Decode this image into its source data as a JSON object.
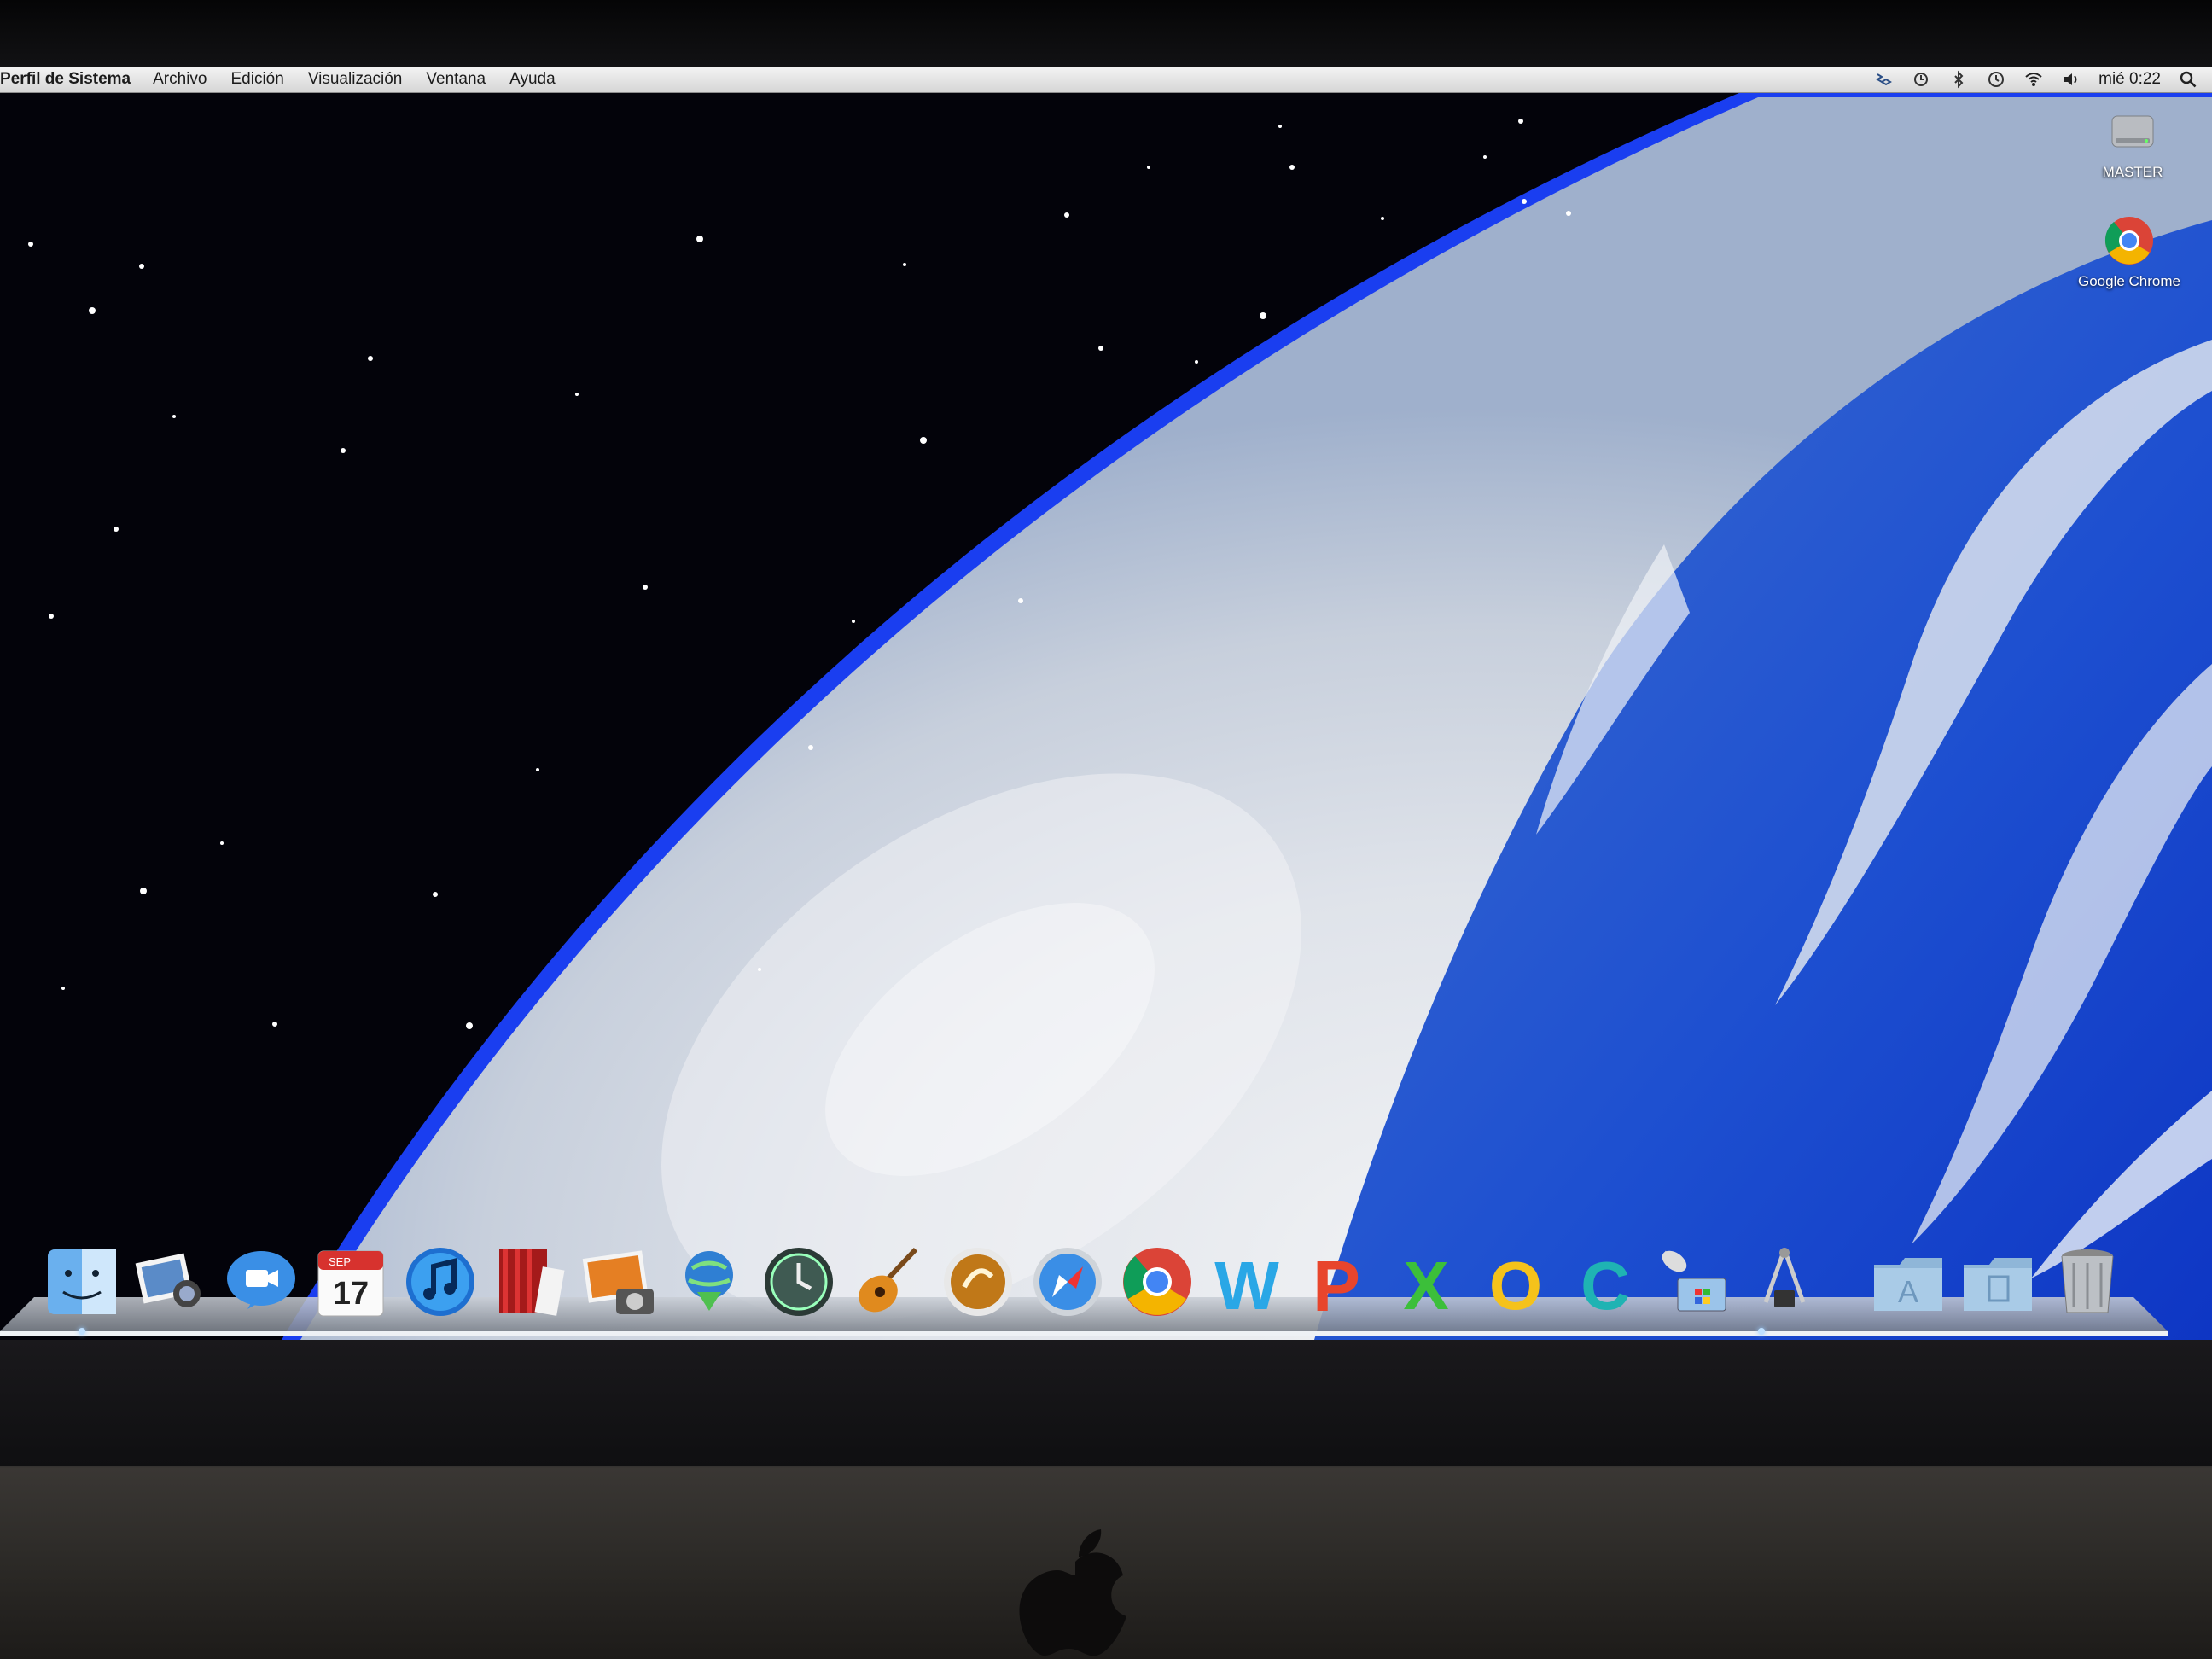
{
  "menubar": {
    "app_name": "Perfil de Sistema",
    "menus": [
      "Archivo",
      "Edición",
      "Visualización",
      "Ventana",
      "Ayuda"
    ],
    "clock": "mié 0:22",
    "status_icons": [
      "dropbox-icon",
      "sync-icon",
      "bluetooth-icon",
      "time-machine-icon",
      "wifi-icon",
      "volume-icon",
      "spotlight-icon"
    ]
  },
  "desktop": {
    "icons": [
      {
        "label": "MASTER",
        "icon": "hard-drive-icon"
      },
      {
        "label": "Google Chrome",
        "icon": "chrome-icon"
      }
    ]
  },
  "dock": {
    "items": [
      "finder-icon",
      "iphoto-preview-icon",
      "facetime-icon",
      "ical-icon",
      "itunes-icon",
      "photo-booth-icon",
      "iphoto-icon",
      "download-globe-icon",
      "time-machine-icon",
      "garageband-icon",
      "wine-bottler-icon",
      "safari-icon",
      "chrome-icon",
      "word-icon",
      "powerpoint-icon",
      "excel-icon",
      "outlook-icon",
      "communicator-icon",
      "remote-desktop-icon",
      "system-profiler-icon",
      "applications-folder-icon",
      "documents-folder-icon",
      "trash-icon"
    ],
    "calendar_month": "SEP",
    "calendar_day": "17",
    "word_letter": "W",
    "powerpoint_letter": "P",
    "excel_letter": "X",
    "outlook_letter": "O",
    "communicator_letter": "C",
    "accent_colors": {
      "word": "#2aa7e6",
      "powerpoint": "#e8452c",
      "excel": "#3cbf3a",
      "outlook": "#f5c21b",
      "communicator": "#1fb3b3"
    }
  }
}
